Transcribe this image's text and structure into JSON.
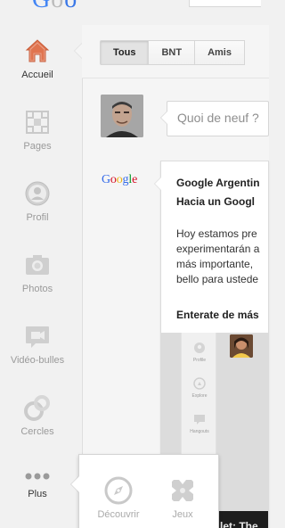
{
  "nav": {
    "items": [
      {
        "label": "Accueil",
        "icon": "home-icon",
        "active": true
      },
      {
        "label": "Pages",
        "icon": "pages-icon"
      },
      {
        "label": "Profil",
        "icon": "profile-icon"
      },
      {
        "label": "Photos",
        "icon": "photos-icon"
      },
      {
        "label": "Vidéo-bulles",
        "icon": "hangouts-icon"
      },
      {
        "label": "Cercles",
        "icon": "circles-icon"
      },
      {
        "label": "Plus",
        "icon": "more-icon"
      }
    ]
  },
  "stream": {
    "tabs": [
      {
        "label": "Tous",
        "selected": true
      },
      {
        "label": "BNT"
      },
      {
        "label": "Amis"
      }
    ]
  },
  "share": {
    "placeholder": "Quoi de neuf ?"
  },
  "post": {
    "logo_text": "Google",
    "author": "Google Argentin",
    "headline": "Hacia un Googl",
    "body_lines": [
      "Hoy estamos pre",
      "experimentarán a",
      "más importante,",
      "bello para ustede"
    ],
    "link_text": "Enterate de más",
    "embed": {
      "nav_labels": [
        "Profile",
        "Explore",
        "Hangouts"
      ],
      "caption": "let: The"
    }
  },
  "more_menu": {
    "items": [
      {
        "label": "Découvrir",
        "icon": "compass-icon"
      },
      {
        "label": "Jeux",
        "icon": "games-icon"
      }
    ]
  },
  "colors": {
    "accent_home": "#e0744f",
    "inactive_icon": "#c6c6c6",
    "google_blue": "#3369e8",
    "google_red": "#d50f25",
    "google_yellow": "#eeb211",
    "google_green": "#009925"
  }
}
